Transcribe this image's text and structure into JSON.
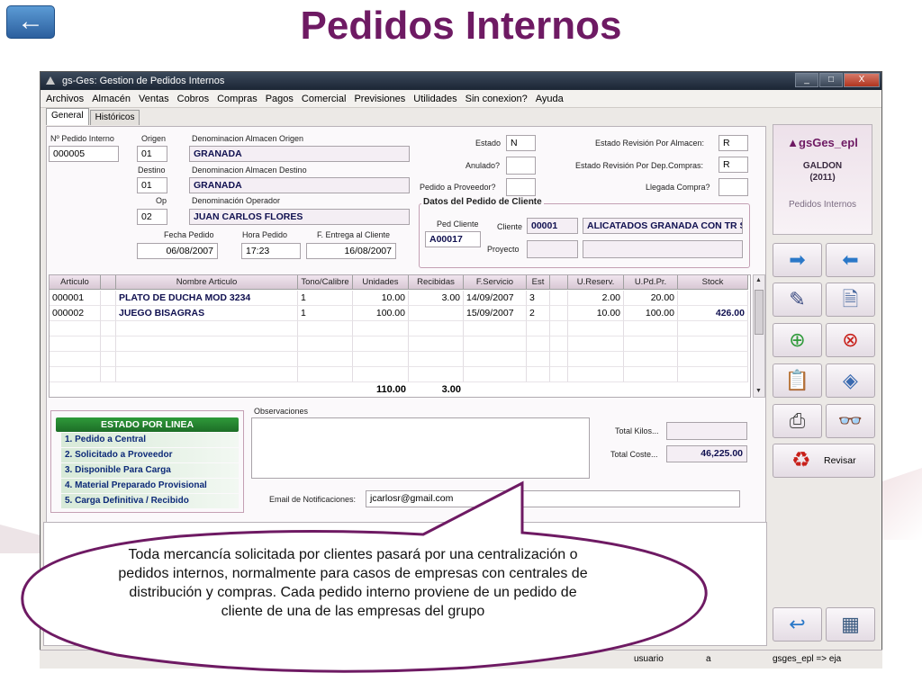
{
  "slide": {
    "title": "Pedidos Internos",
    "back_icon": "←",
    "bubble_text": "Toda mercancía solicitada por clientes pasará por una centralización o pedidos internos, normalmente para casos de empresas con centrales de distribución y compras. Cada pedido interno proviene de un pedido de cliente de una de las empresas del grupo"
  },
  "window": {
    "title": "gs-Ges: Gestion de Pedidos Internos",
    "controls": [
      "_",
      "□",
      "X"
    ]
  },
  "menu": [
    "Archivos",
    "Almacén",
    "Ventas",
    "Cobros",
    "Compras",
    "Pagos",
    "Comercial",
    "Previsiones",
    "Utilidades",
    "Sin conexion?",
    "Ayuda"
  ],
  "tabs": [
    "General",
    "Históricos"
  ],
  "form": {
    "num_pedido_label": "Nº Pedido Interno",
    "num_pedido": "000005",
    "origen_label": "Origen",
    "origen": "01",
    "den_origen_label": "Denominacion Almacen Origen",
    "den_origen": "GRANADA",
    "destino_label": "Destino",
    "destino": "01",
    "den_destino_label": "Denominacion Almacen Destino",
    "den_destino": "GRANADA",
    "op_label": "Op",
    "op": "02",
    "den_operador_label": "Denominación Operador",
    "den_operador": "JUAN CARLOS FLORES",
    "fecha_pedido_label": "Fecha Pedido",
    "fecha_pedido": "06/08/2007",
    "hora_pedido_label": "Hora Pedido",
    "hora_pedido": "17:23",
    "f_entrega_label": "F. Entrega al Cliente",
    "f_entrega": "16/08/2007",
    "estado_label": "Estado",
    "estado": "N",
    "anulado_label": "Anulado?",
    "anulado": "",
    "pedido_proveedor_label": "Pedido a Proveedor?",
    "pedido_proveedor": "",
    "rev_almacen_label": "Estado Revisión Por Almacen:",
    "rev_almacen": "R",
    "rev_compras_label": "Estado Revisión Por Dep.Compras:",
    "rev_compras": "R",
    "llegada_label": "Llegada Compra?",
    "llegada": ""
  },
  "cliente_group": {
    "title": "Datos del Pedido de Cliente",
    "ped_cliente_label": "Ped Cliente",
    "ped_cliente": "A00017",
    "cliente_label": "Cliente",
    "cliente_code": "00001",
    "cliente_name": "ALICATADOS GRANADA CON TR S",
    "proyecto_label": "Proyecto",
    "proyecto": "",
    "proyecto_name": ""
  },
  "grid": {
    "columns": [
      "Articulo",
      "",
      "Nombre Articulo",
      "Tono/Calibre",
      "Unidades",
      "Recibidas",
      "F.Servicio",
      "Est",
      "",
      "U.Reserv.",
      "U.Pd.Pr.",
      "Stock"
    ],
    "rows": [
      [
        "000001",
        "",
        "PLATO DE DUCHA MOD 3234",
        "1",
        "10.00",
        "3.00",
        "14/09/2007",
        "3",
        "",
        "2.00",
        "20.00",
        ""
      ],
      [
        "000002",
        "",
        "JUEGO BISAGRAS",
        "1",
        "100.00",
        "",
        "15/09/2007",
        "2",
        "",
        "10.00",
        "100.00",
        "426.00"
      ]
    ],
    "total_unidades": "110.00",
    "total_recibidas": "3.00"
  },
  "estado_linea": {
    "title": "ESTADO POR LINEA",
    "items": [
      "1. Pedido a Central",
      "2. Solicitado a Proveedor",
      "3. Disponible Para Carga",
      "4. Material Preparado Provisional",
      "5. Carga Definitiva / Recibido"
    ]
  },
  "observaciones_label": "Observaciones",
  "observaciones": "",
  "email_label": "Email de Notificaciones:",
  "email": "jcarlosr@gmail.com",
  "total_kilos_label": "Total Kilos...",
  "total_kilos": "",
  "total_coste_label": "Total Coste...",
  "total_coste": "46,225.00",
  "logo": {
    "brand": "gsGes_epl",
    "company": "GALDON",
    "year": "(2011)",
    "module": "Pedidos Internos"
  },
  "revisar_label": "Revisar",
  "status": {
    "user_label": "usuario",
    "user_value": "a",
    "db": "gsges_epl => eja"
  },
  "colors": {
    "title": "#6e1a63",
    "accent_green": "#2f9a3a",
    "estado_item_text": "#0d2a78"
  }
}
